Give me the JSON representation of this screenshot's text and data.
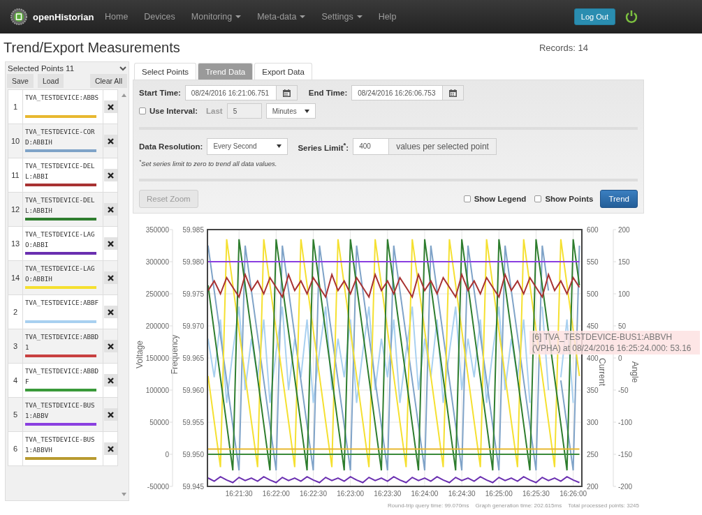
{
  "navbar": {
    "brand": "openHistorian",
    "items": [
      {
        "label": "Home",
        "dropdown": false
      },
      {
        "label": "Devices",
        "dropdown": false
      },
      {
        "label": "Monitoring",
        "dropdown": true
      },
      {
        "label": "Meta-data",
        "dropdown": true
      },
      {
        "label": "Settings",
        "dropdown": true
      },
      {
        "label": "Help",
        "dropdown": false
      }
    ],
    "logout": "Log Out"
  },
  "page": {
    "title": "Trend/Export Measurements",
    "records": "Records: 14"
  },
  "selected_points": {
    "header": "Selected Points 11",
    "buttons": [
      "Save",
      "Load",
      "Clear All"
    ],
    "rows": [
      {
        "index": "1",
        "name": "TVA_TESTDEVICE:ABBS",
        "color": "#e8b830"
      },
      {
        "index": "10",
        "name": "TVA_TESTDEVICE-CORD:ABBIH",
        "color": "#7fa3c8"
      },
      {
        "index": "11",
        "name": "TVA_TESTDEVICE-DELL:ABBI",
        "color": "#a83232"
      },
      {
        "index": "12",
        "name": "TVA_TESTDEVICE-DELL:ABBIH",
        "color": "#2e7d2e"
      },
      {
        "index": "13",
        "name": "TVA_TESTDEVICE-LAGO:ABBI",
        "color": "#6a2fb0"
      },
      {
        "index": "14",
        "name": "TVA_TESTDEVICE-LAGO:ABBIH",
        "color": "#f5e030"
      },
      {
        "index": "2",
        "name": "TVA_TESTDEVICE:ABBF",
        "color": "#a8d0f0"
      },
      {
        "index": "3",
        "name": "TVA_TESTDEVICE:ABBD1",
        "color": "#c84040"
      },
      {
        "index": "4",
        "name": "TVA_TESTDEVICE:ABBDF",
        "color": "#3a9a3a"
      },
      {
        "index": "5",
        "name": "TVA_TESTDEVICE-BUS1:ABBV",
        "color": "#8a3fe0"
      },
      {
        "index": "6",
        "name": "TVA_TESTDEVICE-BUS1:ABBVH",
        "color": "#b89a30"
      }
    ]
  },
  "tabs": [
    {
      "label": "Select Points",
      "selected": false
    },
    {
      "label": "Trend Data",
      "selected": true
    },
    {
      "label": "Export Data",
      "selected": false
    }
  ],
  "form": {
    "start_label": "Start Time:",
    "start_value": "08/24/2016 16:21:06.751",
    "end_label": "End Time:",
    "end_value": "08/24/2016 16:26:06.753",
    "use_interval": {
      "label": "Use Interval:",
      "checked": false
    },
    "last": {
      "label": "Last",
      "value": "5",
      "unit": "Minutes",
      "disabled": true
    },
    "resolution_label": "Data Resolution:",
    "resolution_value": "Every Second",
    "series_limit_label": "Series Limit$^{*}$:",
    "series_limit_value": "400",
    "series_limit_unit": "values per selected point",
    "note": "$^{*}$Set series limit to zero to trend all data values.",
    "reset_zoom": {
      "label": "Reset Zoom",
      "disabled": true
    },
    "show_legend": {
      "label": "Show Legend",
      "checked": false
    },
    "show_points": {
      "label": "Show Points",
      "checked": false
    },
    "trend_button": "Trend"
  },
  "graph": {
    "chart_data": {
      "type": "line",
      "grid": true,
      "ylabel": "Frequency",
      "ylim": [
        59.945,
        59.985
      ],
      "yticks": [
        {
          "value": 59.985,
          "label": "59.985"
        },
        {
          "value": 59.98,
          "label": "59.980"
        },
        {
          "value": 59.975,
          "label": "59.975"
        },
        {
          "value": 59.97,
          "label": "59.970"
        },
        {
          "value": 59.965,
          "label": "59.965"
        },
        {
          "value": 59.96,
          "label": "59.960"
        },
        {
          "value": 59.955,
          "label": "59.955"
        },
        {
          "value": 59.95,
          "label": "59.950"
        },
        {
          "value": 59.945,
          "label": "59.945"
        }
      ],
      "categories": [
        null,
        null,
        null,
        null,
        null,
        "16:21:30",
        null,
        null,
        null,
        null,
        null,
        "16:22:00",
        null,
        null,
        null,
        null,
        null,
        "16:22:30",
        null,
        null,
        null,
        null,
        null,
        "16:23:00",
        null,
        null,
        null,
        null,
        null,
        "16:23:30",
        null,
        null,
        null,
        null,
        null,
        "16:24:00",
        null,
        null,
        null,
        null,
        null,
        "16:24:30",
        null,
        null,
        null,
        null,
        null,
        "16:25:00",
        null,
        null,
        null,
        null,
        null,
        "16:25:30",
        null,
        null,
        null,
        null,
        null,
        "16:26:00",
        null
      ],
      "series": [
        {
          "color": "#a8d0f0",
          "values": [
            59.968,
            59.962,
            59.971,
            59.958,
            59.966,
            59.973,
            59.96,
            59.968,
            59.962,
            59.971,
            59.958,
            59.966,
            59.973,
            59.96,
            59.968,
            59.962,
            59.971,
            59.958,
            59.966,
            59.973,
            59.96,
            59.968,
            59.962,
            59.971,
            59.958,
            59.966,
            59.973,
            59.96,
            59.968,
            59.962,
            59.971,
            59.958,
            59.966,
            59.973,
            59.96,
            59.968,
            59.962,
            59.971,
            59.958,
            59.966,
            59.973,
            59.96,
            59.968,
            59.962,
            59.971,
            59.958,
            59.966,
            59.973,
            59.96,
            59.968,
            59.962,
            59.971,
            59.958,
            null,
            59.973,
            59.96,
            null,
            59.962,
            59.971,
            59.958,
            null
          ]
        },
        {
          "color": "#7fa3c8",
          "values": [
            59.9825,
            59.9755,
            59.9685,
            59.9615,
            59.9545,
            59.9475,
            59.9825,
            59.9755,
            59.9685,
            59.9615,
            59.9545,
            59.9475,
            59.9825,
            59.9755,
            59.9685,
            59.9615,
            59.9545,
            59.9475,
            59.9825,
            59.9755,
            59.9685,
            59.9615,
            59.9545,
            59.9475,
            59.9825,
            59.9755,
            59.9685,
            59.9615,
            59.9545,
            59.9475,
            59.9825,
            59.9755,
            59.9685,
            59.9615,
            59.9545,
            59.9475,
            59.9825,
            59.9755,
            59.9685,
            59.9615,
            59.9545,
            59.9475,
            59.9825,
            59.9755,
            59.9685,
            59.9615,
            59.9545,
            59.9475,
            59.9825,
            59.9755,
            59.9685,
            59.9615,
            59.9545,
            59.9475,
            59.9825,
            59.9755,
            null,
            59.9615,
            59.9545,
            59.9475,
            59.9825
          ]
        },
        {
          "color": "#f5e030",
          "values": [
            59.9622,
            59.9551,
            59.948,
            59.9835,
            59.9764,
            59.9693,
            59.9622,
            59.9551,
            59.948,
            59.9835,
            59.9764,
            59.9693,
            59.9622,
            59.9551,
            59.948,
            59.9835,
            59.9764,
            59.9693,
            59.9622,
            59.9551,
            59.948,
            59.9835,
            59.9764,
            59.9693,
            59.9622,
            59.9551,
            59.948,
            59.9835,
            59.9764,
            59.9693,
            59.9622,
            59.9551,
            59.948,
            59.9835,
            59.9764,
            59.9693,
            59.9622,
            59.9551,
            59.948,
            59.9835,
            59.9764,
            59.9693,
            59.9622,
            59.9551,
            59.948,
            59.9835,
            59.9764,
            59.9693,
            59.9622,
            59.9551,
            59.948,
            59.9835,
            59.9764,
            59.9693,
            59.9622,
            59.9551,
            59.948,
            59.9835,
            59.9764,
            59.9693,
            59.9622
          ]
        },
        {
          "color": "#2e7d2e",
          "values": [
            59.9763,
            59.9691,
            59.9619,
            59.9547,
            59.9475,
            59.9835,
            59.9763,
            59.9691,
            59.9619,
            59.9547,
            59.9475,
            59.9835,
            59.9763,
            59.9691,
            59.9619,
            59.9547,
            59.9475,
            59.9835,
            59.9763,
            59.9691,
            59.9619,
            59.9547,
            59.9475,
            59.9835,
            59.9763,
            59.9691,
            59.9619,
            59.9547,
            59.9475,
            59.9835,
            59.9763,
            59.9691,
            59.9619,
            59.9547,
            59.9475,
            59.9835,
            59.9763,
            59.9691,
            59.9619,
            59.9547,
            59.9475,
            59.9835,
            59.9763,
            59.9691,
            59.9619,
            59.9547,
            59.9475,
            59.9835,
            59.9763,
            59.9691,
            59.9619,
            59.9547,
            59.9475,
            59.9835,
            59.9763,
            59.9691,
            59.9619,
            59.9547,
            59.9475,
            59.9835,
            59.9763
          ]
        },
        {
          "color": "#a83232",
          "values": [
            59.9755,
            59.977,
            59.975,
            59.9775,
            59.976,
            59.9745,
            59.978,
            59.9755,
            59.977,
            59.975,
            59.9775,
            59.976,
            59.9745,
            59.978,
            59.9755,
            59.977,
            59.975,
            59.9775,
            59.976,
            59.9745,
            59.978,
            59.9755,
            59.977,
            59.975,
            59.9775,
            59.976,
            59.9745,
            59.978,
            59.9755,
            59.977,
            59.975,
            59.9775,
            59.976,
            59.9745,
            59.978,
            59.9755,
            59.977,
            59.975,
            59.9775,
            59.976,
            59.9745,
            59.978,
            59.9755,
            59.977,
            59.975,
            59.9775,
            59.976,
            59.9745,
            59.978,
            59.9755,
            59.977,
            59.975,
            59.9775,
            59.976,
            59.9745,
            59.978,
            59.9755,
            59.977,
            59.975,
            59.9775,
            59.976
          ]
        },
        {
          "color": "#8a3fe0",
          "values": [
            59.98,
            59.98,
            59.98,
            59.98,
            59.98,
            59.98,
            59.98,
            59.98,
            59.98,
            59.98,
            59.98,
            59.98,
            59.98,
            59.98,
            59.98,
            59.98,
            59.98,
            59.98,
            59.98,
            59.98,
            59.98,
            59.98,
            59.98,
            59.98,
            59.98,
            59.98,
            59.98,
            59.98,
            59.98,
            59.98,
            59.98,
            59.98,
            59.98,
            59.98,
            59.98,
            59.98,
            59.98,
            59.98,
            59.98,
            59.98,
            59.98,
            59.98,
            59.98,
            59.98,
            59.98,
            59.98,
            59.98,
            59.98,
            59.98,
            59.98,
            59.98,
            59.98,
            59.98,
            59.98,
            59.98,
            59.98,
            59.98,
            59.98,
            59.98,
            59.98,
            59.98
          ]
        },
        {
          "color": "#e8b830",
          "values": [
            59.9508,
            59.9508,
            59.9508,
            59.9508,
            59.9508,
            59.9508,
            59.9508,
            59.9508,
            59.9508,
            59.9508,
            59.9508,
            59.9508,
            59.9508,
            59.9508,
            59.9508,
            59.9508,
            59.9508,
            59.9508,
            59.9508,
            59.9508,
            59.9508,
            59.9508,
            59.9508,
            59.9508,
            59.9508,
            59.9508,
            59.9508,
            59.9508,
            59.9508,
            59.9508,
            59.9508,
            59.9508,
            59.9508,
            59.9508,
            59.9508,
            59.9508,
            59.9508,
            59.9508,
            59.9508,
            59.9508,
            59.9508,
            59.9508,
            59.9508,
            59.9508,
            59.9508,
            59.9508,
            59.9508,
            59.9508,
            59.9508,
            59.9508,
            59.9508,
            59.9508,
            59.9508,
            59.9508,
            59.9508,
            59.9508,
            59.9508,
            59.9508,
            59.9508,
            59.9508,
            59.9508
          ]
        },
        {
          "color": "#3a8a3a",
          "values": [
            59.95,
            59.95,
            59.95,
            59.95,
            59.95,
            59.95,
            59.95,
            59.95,
            59.95,
            59.95,
            59.95,
            59.95,
            59.95,
            59.95,
            59.95,
            59.95,
            59.95,
            59.95,
            59.95,
            59.95,
            59.95,
            59.95,
            59.95,
            59.95,
            59.95,
            59.95,
            59.95,
            59.95,
            59.95,
            59.95,
            59.95,
            59.95,
            59.95,
            59.95,
            59.95,
            59.95,
            59.95,
            59.95,
            59.95,
            59.95,
            59.95,
            59.95,
            59.95,
            59.95,
            59.95,
            59.95,
            59.95,
            59.95,
            59.95,
            59.95,
            59.95,
            59.95,
            59.95,
            59.95,
            59.95,
            59.95,
            59.95,
            59.95,
            59.95,
            59.95,
            59.95
          ]
        },
        {
          "color": "#6a2fb0",
          "values": [
            59.9463,
            59.9458,
            59.9465,
            59.946,
            59.9456,
            59.9464,
            59.9459,
            59.9463,
            59.9458,
            59.9465,
            59.946,
            59.9456,
            59.9464,
            59.9459,
            59.9463,
            59.9458,
            59.9465,
            59.946,
            59.9456,
            59.9464,
            59.9459,
            59.9463,
            59.9458,
            59.9465,
            59.946,
            59.9456,
            59.9464,
            59.9459,
            59.9463,
            59.9458,
            59.9465,
            59.946,
            59.9456,
            59.9464,
            59.9459,
            59.9463,
            59.9458,
            59.9465,
            59.946,
            59.9456,
            59.9464,
            59.9459,
            59.9463,
            59.9458,
            59.9465,
            59.946,
            59.9456,
            59.9464,
            59.9459,
            59.9463,
            59.9458,
            59.9465,
            59.946,
            59.9456,
            59.9464,
            59.9459,
            59.9463,
            59.9458,
            59.9465,
            59.946,
            59.9456
          ]
        }
      ]
    },
    "extra_axes": [
      {
        "title": "Voltage",
        "ticks": [
          "350000",
          "300000",
          "250000",
          "200000",
          "150000",
          "100000",
          "50000",
          "0",
          "-50000"
        ]
      },
      {
        "title": "Current",
        "ticks": [
          "600",
          "550",
          "500",
          "450",
          "400",
          "350",
          "300",
          "250",
          "200"
        ]
      },
      {
        "title": "Angle",
        "ticks": [
          "200",
          "150",
          "100",
          "50",
          "0",
          "-50",
          "-100",
          "-150",
          "-200"
        ]
      }
    ],
    "tooltip": "[6] TVA_TESTDEVICE-BUS1:ABBVH (VPHA) at 08/24/2016 16:25:24.000: 53.16"
  },
  "stats": [
    "Round-trip query time: 99.070ms",
    "Graph generation time: 202.615ms",
    "Total processed points: 3245"
  ]
}
